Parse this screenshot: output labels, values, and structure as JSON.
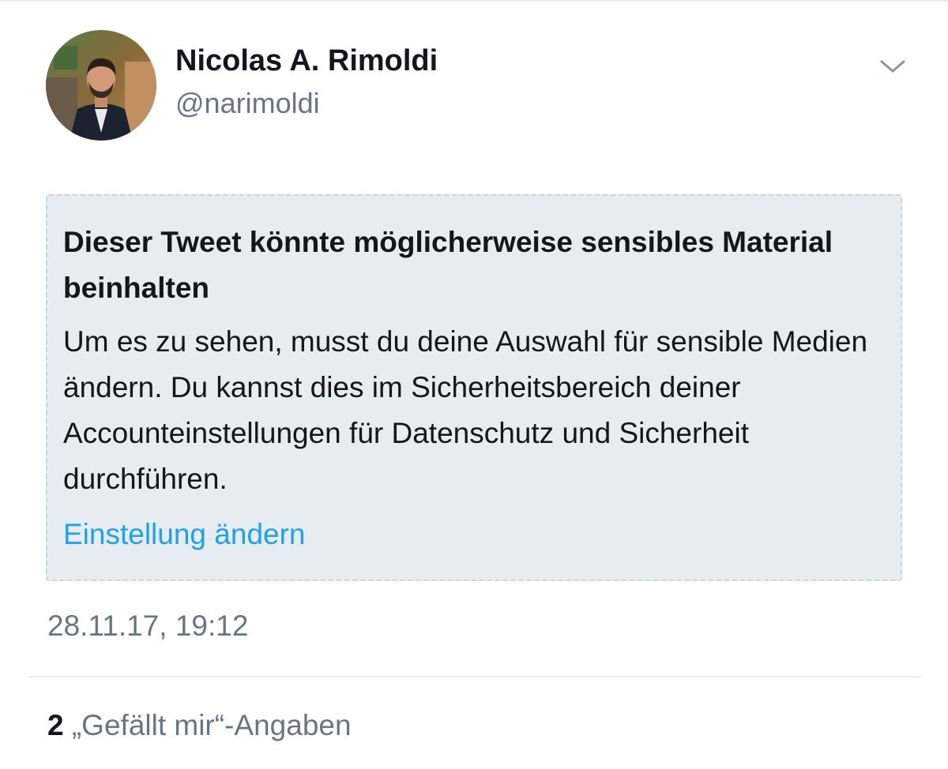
{
  "tweet": {
    "author": {
      "display_name": "Nicolas A. Rimoldi",
      "handle": "@narimoldi",
      "avatar_icon": "profile-photo"
    },
    "menu_icon": "chevron-down-icon",
    "sensitive_notice": {
      "title": "Dieser Tweet könnte möglicherweise sensibles Material beinhalten",
      "body": "Um es zu sehen, musst du deine Auswahl für sensible Medien ändern. Du kannst dies im Sicherheitsbereich deiner Accounteinstellungen für Datenschutz und Sicherheit durchführen.",
      "link_label": "Einstellung ändern"
    },
    "timestamp": "28.11.17, 19:12",
    "likes": {
      "count": "2",
      "label": "„Gefällt mir“-Angaben"
    }
  },
  "colors": {
    "text_primary": "#14171a",
    "text_secondary": "#657786",
    "link": "#1da1f2",
    "notice_background": "#e6ecf0",
    "notice_border": "#ccd6dd",
    "divider": "#e6ecf0"
  }
}
